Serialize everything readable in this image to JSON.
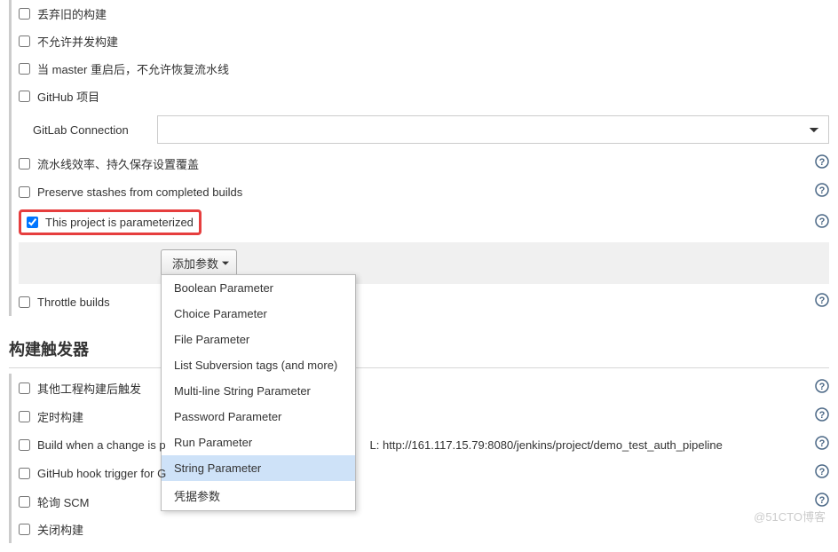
{
  "general": {
    "discard_old": "丢弃旧的构建",
    "no_concurrent": "不允许并发构建",
    "no_resume_master": "当 master 重启后，不允许恢复流水线",
    "github_project": "GitHub 项目",
    "gitlab_conn_label": "GitLab Connection",
    "gitlab_conn_value": "",
    "pipeline_speed": "流水线效率、持久保存设置覆盖",
    "preserve_stashes": "Preserve stashes from completed builds",
    "parameterized": "This project is parameterized",
    "add_param_btn": "添加参数",
    "throttle_builds": "Throttle builds"
  },
  "param_menu": [
    "Boolean Parameter",
    "Choice Parameter",
    "File Parameter",
    "List Subversion tags (and more)",
    "Multi-line String Parameter",
    "Password Parameter",
    "Run Parameter",
    "String Parameter",
    "凭据参数"
  ],
  "param_menu_selected_index": 7,
  "triggers": {
    "section_title": "构建触发器",
    "other_project": "其他工程构建后触发",
    "timed_build": "定时构建",
    "build_on_change_prefix": "Build when a change is p",
    "build_on_change_url": "L: http://161.117.15.79:8080/jenkins/project/demo_test_auth_pipeline",
    "github_hook_prefix": "GitHub hook trigger for G",
    "poll_scm": "轮询 SCM",
    "close_build": "关闭构建"
  },
  "watermark": "@51CTO博客"
}
